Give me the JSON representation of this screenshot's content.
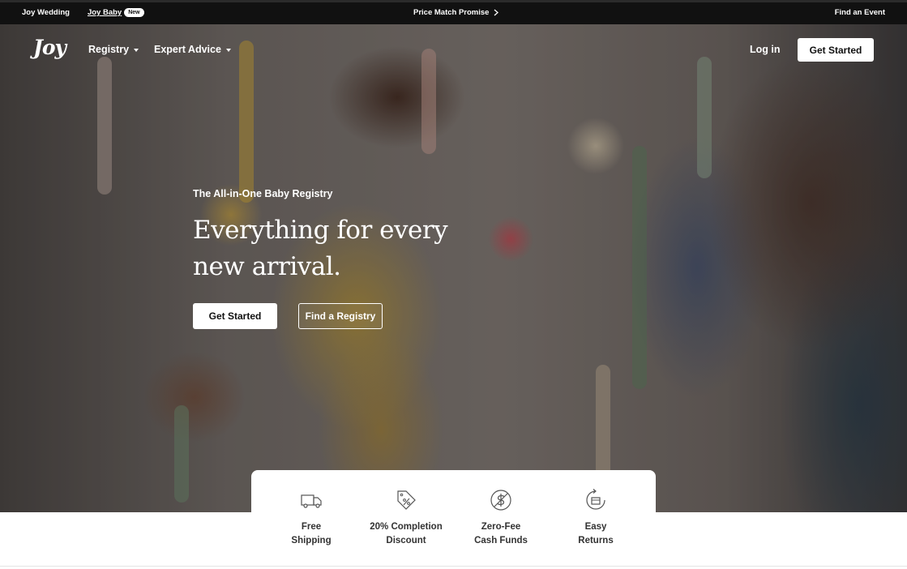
{
  "topbar": {
    "links": [
      {
        "label": "Joy Wedding"
      },
      {
        "label": "Joy Baby",
        "badge": "New"
      }
    ],
    "promo": "Price Match Promise",
    "right_link": "Find an Event"
  },
  "nav": {
    "logo": "Joy",
    "menu": [
      {
        "label": "Registry"
      },
      {
        "label": "Expert Advice"
      }
    ],
    "login": "Log in",
    "cta": "Get Started"
  },
  "hero": {
    "eyebrow": "The All-in-One Baby Registry",
    "headline": "Everything for every new arrival.",
    "primary_button": "Get Started",
    "secondary_button": "Find a Registry"
  },
  "features": [
    {
      "icon": "truck-icon",
      "label": "Free\nShipping"
    },
    {
      "icon": "discount-tag-icon",
      "label": "20% Completion\nDiscount"
    },
    {
      "icon": "no-fee-dollar-icon",
      "label": "Zero-Fee\nCash Funds"
    },
    {
      "icon": "return-box-icon",
      "label": "Easy\nReturns"
    }
  ]
}
